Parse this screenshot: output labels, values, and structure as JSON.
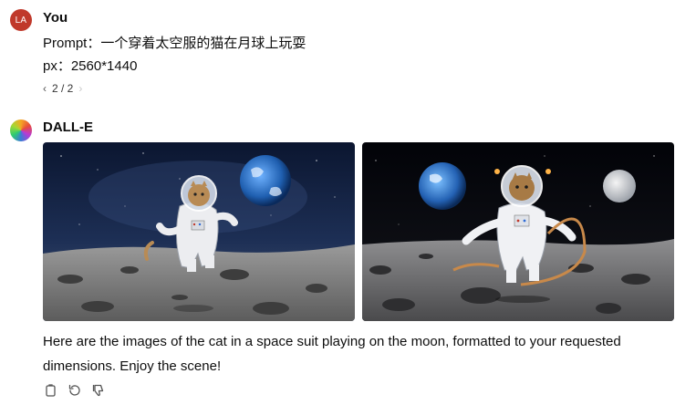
{
  "user": {
    "initials": "LA",
    "name": "You",
    "prompt_line": "Prompt：一个穿着太空服的猫在月球上玩耍",
    "px_line": "px：2560*1440",
    "pager": {
      "prev": "‹",
      "label": "2 / 2",
      "next": "›"
    }
  },
  "assistant": {
    "name": "DALL-E",
    "images": [
      {
        "subject": "cat-astronaut-moon-1"
      },
      {
        "subject": "cat-astronaut-moon-2"
      }
    ],
    "reply": "Here are the images of the cat in a space suit playing on the moon, formatted to your requested dimensions. Enjoy the scene!",
    "actions": [
      "copy-icon",
      "regenerate-icon",
      "thumbs-down-icon"
    ]
  },
  "colors": {
    "user_avatar": "#c0392b",
    "text": "#0d0d0d"
  }
}
